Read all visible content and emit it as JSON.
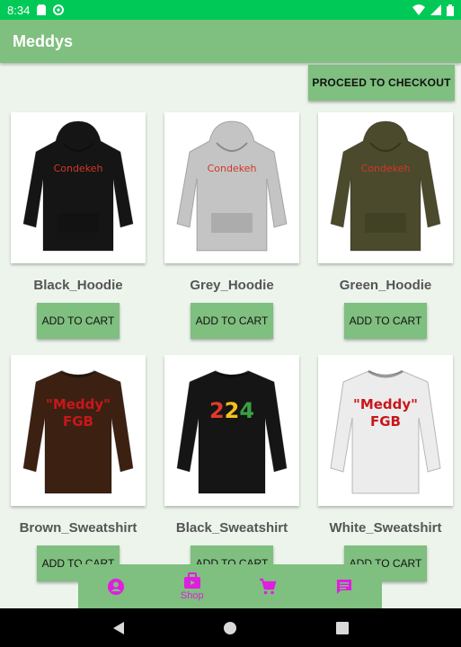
{
  "status_bar": {
    "time": "8:34"
  },
  "app_bar": {
    "title": "Meddys"
  },
  "checkout": {
    "label": "PROCEED TO CHECKOUT"
  },
  "products": [
    {
      "name": "Black_Hoodie",
      "button": "ADD TO CART",
      "color": "#151515",
      "print": "Condekeh",
      "print_color": "#d0382a",
      "kind": "hoodie"
    },
    {
      "name": "Grey_Hoodie",
      "button": "ADD TO CART",
      "color": "#c4c4c4",
      "print": "Condekeh",
      "print_color": "#d0382a",
      "kind": "hoodie"
    },
    {
      "name": "Green_Hoodie",
      "button": "ADD TO CART",
      "color": "#4b4a2c",
      "print": "Condekeh",
      "print_color": "#d0382a",
      "kind": "hoodie"
    },
    {
      "name": "Brown_Sweatshirt",
      "button": "ADD TO CART",
      "color": "#3c2112",
      "print": "\"Meddy\" FGB",
      "print_color": "#c8171c",
      "kind": "sweatshirt"
    },
    {
      "name": "Black_Sweatshirt",
      "button": "ADD TO CART",
      "color": "#151515",
      "print": "224",
      "print_color": "#e03a2a",
      "kind": "sweatshirt"
    },
    {
      "name": "White_Sweatshirt",
      "button": "ADD TO CART",
      "color": "#ececec",
      "print": "\"Meddy\" FGB",
      "print_color": "#c8171c",
      "kind": "sweatshirt"
    }
  ],
  "bottom_nav": {
    "items": [
      {
        "icon": "account-icon",
        "label": ""
      },
      {
        "icon": "shop-icon",
        "label": "Shop"
      },
      {
        "icon": "cart-icon",
        "label": ""
      },
      {
        "icon": "message-icon",
        "label": ""
      }
    ]
  },
  "colors": {
    "accent": "#7fbf7f",
    "nav_icon": "#e01ee0",
    "status_bar": "#00c957"
  }
}
